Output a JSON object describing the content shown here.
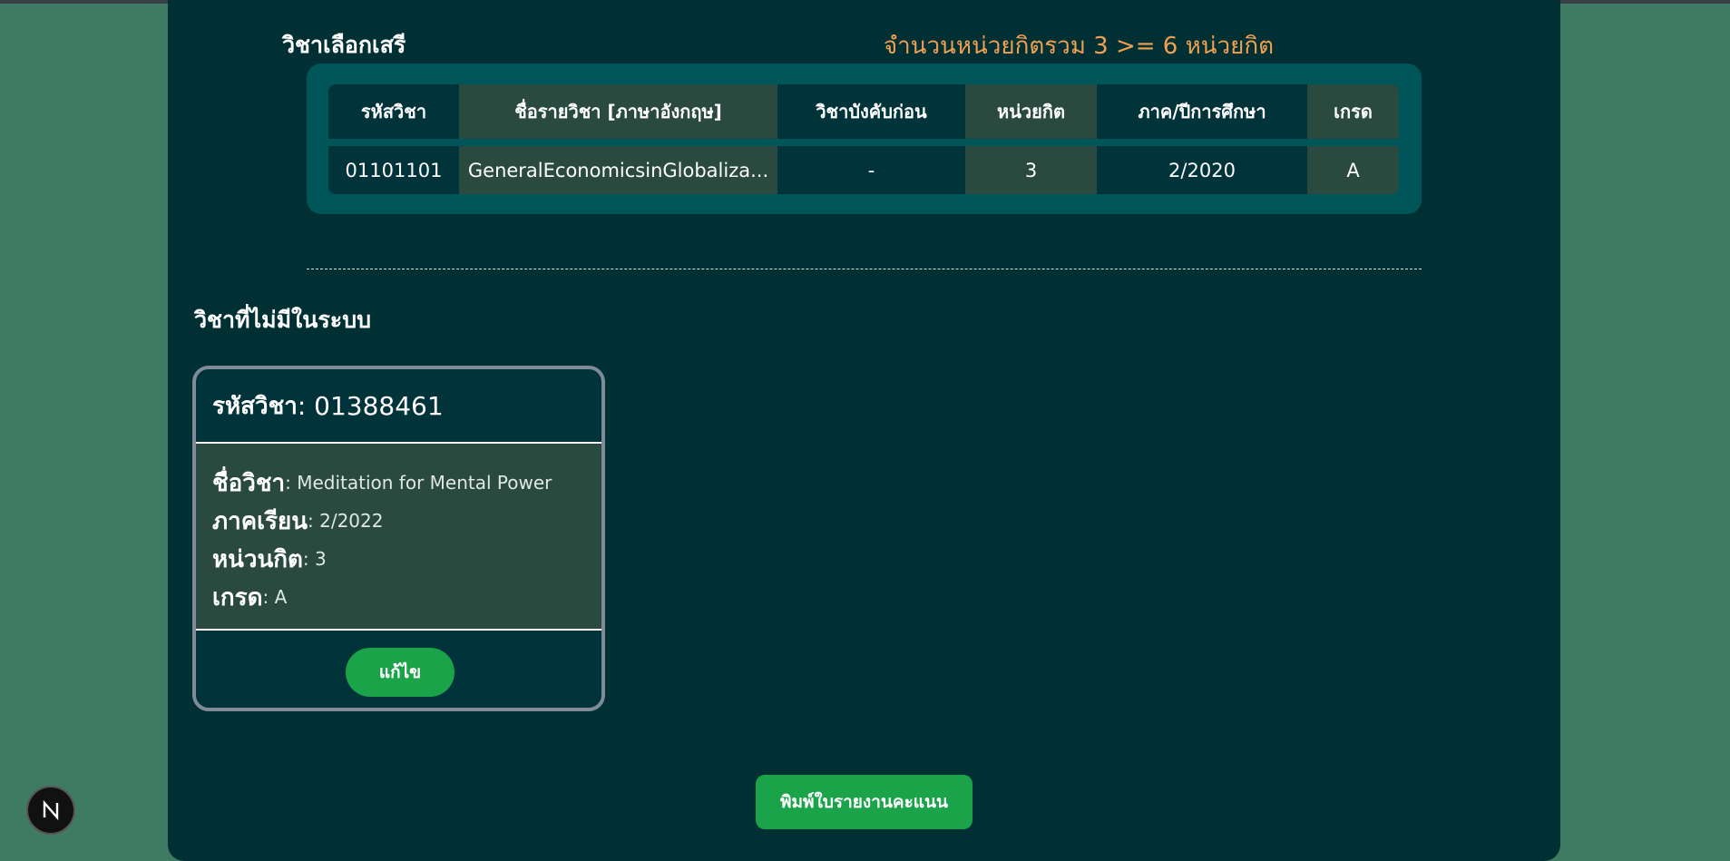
{
  "elective": {
    "title": "วิชาเลือกเสรี",
    "credit_summary": "จำนวนหน่วยกิตรวม 3 >= 6 หน่วยกิต",
    "table": {
      "headers": [
        "รหัสวิชา",
        "ชื่อรายวิชา [ภาษาอังกฤษ]",
        "วิชาบังคับก่อน",
        "หน่วยกิต",
        "ภาค/ปีการศึกษา",
        "เกรด"
      ],
      "rows": [
        [
          "01101101",
          "GeneralEconomicsinGlobaliza...",
          "-",
          "3",
          "2/2020",
          "A"
        ]
      ]
    }
  },
  "not_in_system": {
    "title": "วิชาที่ไม่มีในระบบ",
    "card": {
      "code_label": "รหัสวิชา",
      "code_value": "01388461",
      "name_label": "ชื่อวิชา",
      "name_value": "Meditation for Mental Power",
      "semester_label": "ภาคเรียน",
      "semester_value": "2/2022",
      "credit_label": "หน่วนกิต",
      "credit_value": "3",
      "grade_label": "เกรด",
      "grade_value": "A",
      "edit_label": "แก้ไข"
    }
  },
  "print_button": "พิมพ์ใบรายงานคะแนน",
  "badge_icon": "nextjs-n-icon",
  "colors": {
    "page_bg": "#3f7a63",
    "panel_bg": "#003034",
    "table_frame": "#005558",
    "accent_orange": "#f0a050",
    "button_green": "#1aa349"
  }
}
